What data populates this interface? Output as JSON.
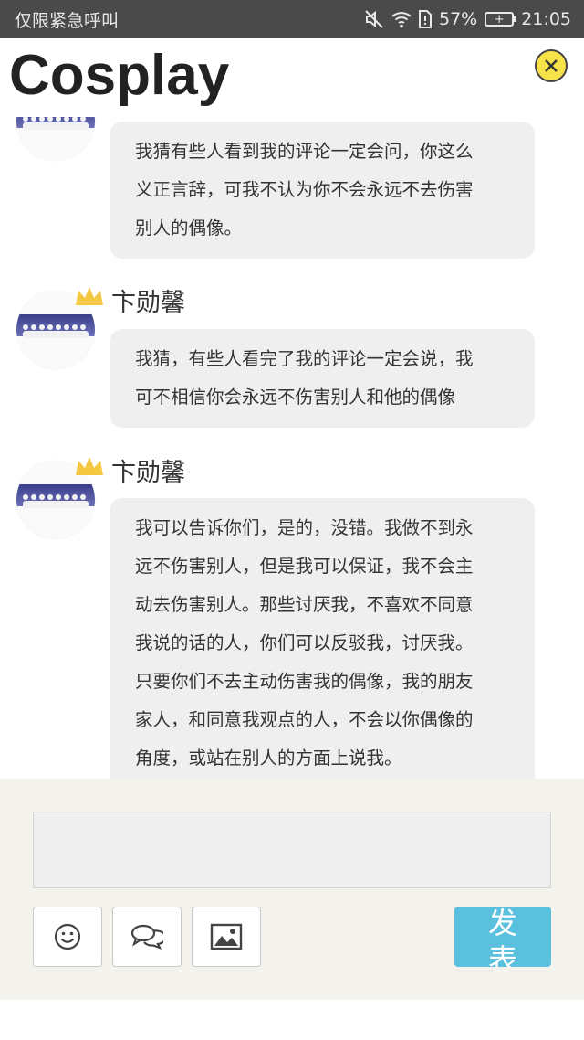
{
  "status_bar": {
    "carrier": "仅限紧急呼叫",
    "battery_percent": "57%",
    "time": "21:05"
  },
  "header": {
    "title": "Cosplay"
  },
  "comments": [
    {
      "name": "",
      "lines": [
        "我猜有些人看到我的评论一定会问，你这么",
        "义正言辞，可我不认为你不会永远不去伤害",
        "别人的偶像。"
      ]
    },
    {
      "name": "卞勋馨",
      "lines": [
        "我猜，有些人看完了我的评论一定会说，我",
        "可不相信你会永远不伤害别人和他的偶像"
      ]
    },
    {
      "name": "卞勋馨",
      "lines": [
        "我可以告诉你们，是的，没错。我做不到永",
        "远不伤害别人，但是我可以保证，我不会主",
        "动去伤害别人。那些讨厌我，不喜欢不同意",
        "我说的话的人，你们可以反驳我，讨厌我。",
        "只要你们不去主动伤害我的偶像，我的朋友",
        "家人，和同意我观点的人，不会以你偶像的",
        "角度，或站在别人的方面上说我。"
      ]
    }
  ],
  "composer": {
    "input_value": "",
    "send_label_1": "发",
    "send_label_2": "表"
  },
  "colors": {
    "send_button": "#5bc0de",
    "close_button": "#f7e24a",
    "bottom_panel": "#f4f2ec",
    "bubble": "#efefef",
    "crown": "#f5c842"
  },
  "icons": [
    "mute-icon",
    "wifi-icon",
    "sim-icon",
    "battery-icon",
    "close-icon",
    "crown-icon",
    "smiley-icon",
    "chat-bubbles-icon",
    "image-icon"
  ]
}
